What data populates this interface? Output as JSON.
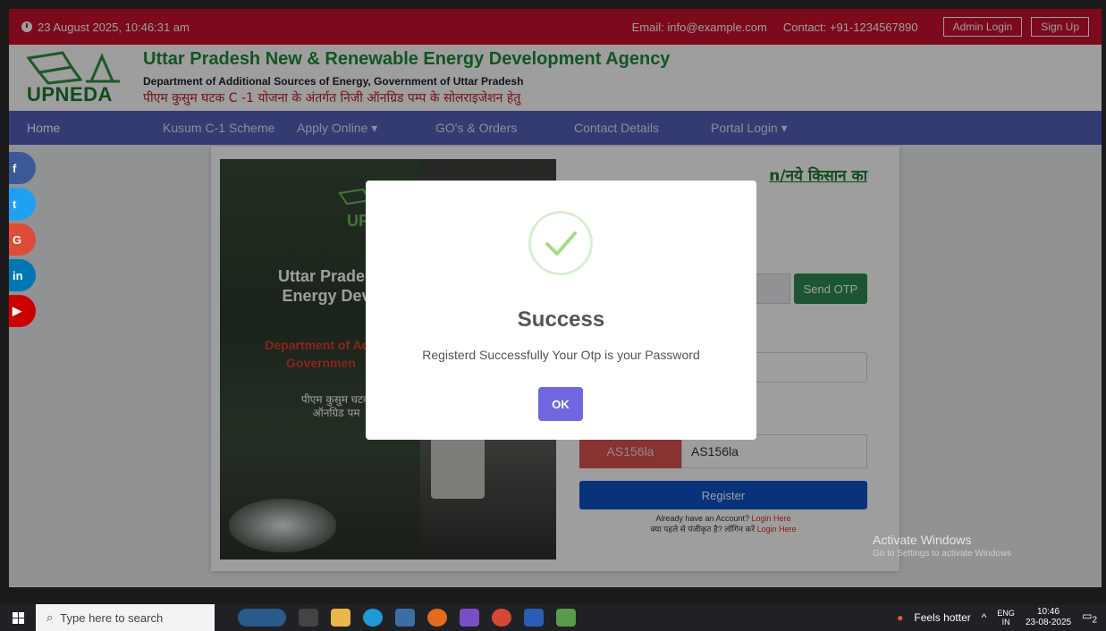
{
  "topbar": {
    "datetime": "23 August 2025, 10:46:31 am",
    "email": "Email: info@example.com",
    "contact": "Contact: +91-1234567890",
    "admin_login": "Admin Login",
    "sign_up": "Sign Up"
  },
  "header": {
    "logo_text": "UPNEDA",
    "title": "Uttar Pradesh New & Renewable Energy Development Agency",
    "subtitle": "Department of Additional Sources of Energy, Government of Uttar Pradesh",
    "hindi_line": "पीएम कुसुम घटक C -1 योजना के अंतर्गत निजी ऑनग्रिड पम्प के सोलराइजेशन हेतु"
  },
  "nav": {
    "items": [
      {
        "label": "Home"
      },
      {
        "label": "Kusum C-1 Scheme"
      },
      {
        "label": "Apply Online ▾"
      },
      {
        "label": "GO's & Orders"
      },
      {
        "label": "Contact Details"
      },
      {
        "label": "Portal Login ▾"
      }
    ]
  },
  "social": [
    {
      "label": "f",
      "color": "#3b5998"
    },
    {
      "label": "t",
      "color": "#1da1f2"
    },
    {
      "label": "G",
      "color": "#dd4b39"
    },
    {
      "label": "in",
      "color": "#0077b5"
    },
    {
      "label": "▶",
      "color": "#cc0000"
    }
  ],
  "banner": {
    "logo_text": "UP",
    "line1": "Uttar Pradesh",
    "line2": "Energy Deve",
    "dept1": "Department of Add",
    "dept2": "Governmen",
    "hindi1": "पीएम कुसुम घटक",
    "hindi2": "ऑनग्रिड पम"
  },
  "form": {
    "title": "n/नये किसान का",
    "send_otp": "Send OTP",
    "captcha_code": "AS156la",
    "captcha_value": "AS156la",
    "register": "Register",
    "already_en": "Already have an Account?",
    "already_hi": "क्या पहले से पंजीकृत है? लॉगिन करें",
    "login_here": "Login Here"
  },
  "watermark": {
    "title": "Activate Windows",
    "sub": "Go to Settings to activate Windows"
  },
  "modal": {
    "title": "Success",
    "message": "Registerd Successfully Your Otp is your Password",
    "ok": "OK"
  },
  "taskbar": {
    "search_placeholder": "Type here to search",
    "weather": "Feels hotter",
    "lang1": "ENG",
    "lang2": "IN",
    "time": "10:46",
    "date": "23-08-2025",
    "notifications": "2"
  }
}
